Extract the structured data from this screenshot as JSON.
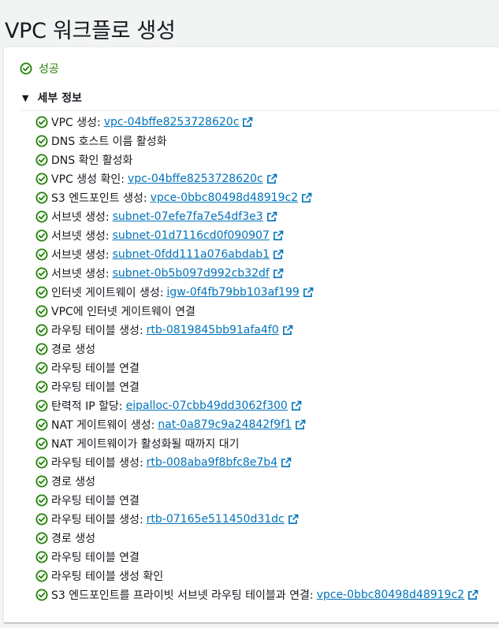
{
  "page": {
    "title": "VPC 워크플로 생성"
  },
  "status": {
    "label": "성공",
    "icon": "check-circle-icon",
    "color": "#1d8102"
  },
  "details": {
    "label": "세부 정보",
    "expanded": true,
    "icon": "caret-down-icon"
  },
  "colors": {
    "success": "#1d8102",
    "link": "#0073bb"
  },
  "steps": [
    {
      "text": "VPC 생성:",
      "link": "vpc-04bffe8253728620c"
    },
    {
      "text": "DNS 호스트 이름 활성화",
      "link": null
    },
    {
      "text": "DNS 확인 활성화",
      "link": null
    },
    {
      "text": "VPC 생성 확인:",
      "link": "vpc-04bffe8253728620c"
    },
    {
      "text": "S3 엔드포인트 생성:",
      "link": "vpce-0bbc80498d48919c2"
    },
    {
      "text": "서브넷 생성:",
      "link": "subnet-07efe7fa7e54df3e3"
    },
    {
      "text": "서브넷 생성:",
      "link": "subnet-01d7116cd0f090907"
    },
    {
      "text": "서브넷 생성:",
      "link": "subnet-0fdd111a076abdab1"
    },
    {
      "text": "서브넷 생성:",
      "link": "subnet-0b5b097d992cb32df"
    },
    {
      "text": "인터넷 게이트웨이 생성:",
      "link": "igw-0f4fb79bb103af199"
    },
    {
      "text": "VPC에 인터넷 게이트웨이 연결",
      "link": null
    },
    {
      "text": "라우팅 테이블 생성:",
      "link": "rtb-0819845bb91afa4f0"
    },
    {
      "text": "경로 생성",
      "link": null
    },
    {
      "text": "라우팅 테이블 연결",
      "link": null
    },
    {
      "text": "라우팅 테이블 연결",
      "link": null
    },
    {
      "text": "탄력적 IP 할당:",
      "link": "eipalloc-07cbb49dd3062f300"
    },
    {
      "text": "NAT 게이트웨이 생성:",
      "link": "nat-0a879c9a24842f9f1"
    },
    {
      "text": "NAT 게이트웨이가 활성화될 때까지 대기",
      "link": null
    },
    {
      "text": "라우팅 테이블 생성:",
      "link": "rtb-008aba9f8bfc8e7b4"
    },
    {
      "text": "경로 생성",
      "link": null
    },
    {
      "text": "라우팅 테이블 연결",
      "link": null
    },
    {
      "text": "라우팅 테이블 생성:",
      "link": "rtb-07165e511450d31dc"
    },
    {
      "text": "경로 생성",
      "link": null
    },
    {
      "text": "라우팅 테이블 연결",
      "link": null
    },
    {
      "text": "라우팅 테이블 생성 확인",
      "link": null
    },
    {
      "text": "S3 엔드포인트를 프라이빗 서브넷 라우팅 테이블과 연결:",
      "link": "vpce-0bbc80498d48919c2"
    }
  ]
}
